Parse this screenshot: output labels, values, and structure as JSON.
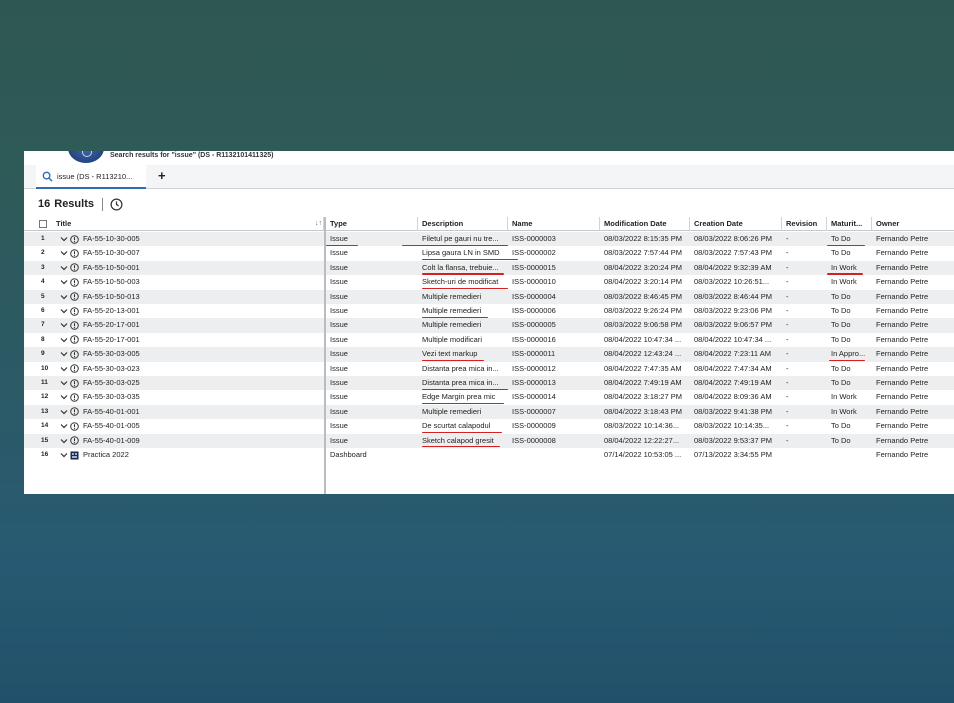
{
  "header": {
    "search_caption": "Search results for \"issue\" (DS - R1132101411325)"
  },
  "tabs": [
    {
      "label": "issue (DS - R113210...",
      "icon": "search-icon"
    }
  ],
  "tab_add_label": "+",
  "results": {
    "count": "16",
    "label": "Results",
    "history_icon": "clock-icon"
  },
  "columns": [
    "Title",
    "Type",
    "Description",
    "Name",
    "Modification Date",
    "Creation Date",
    "Revision",
    "Maturit...",
    "Owner"
  ],
  "colors": {
    "accent": "#2f6db5",
    "annotation_underline": "#d62020"
  },
  "rows": [
    {
      "num": "1",
      "title": "FA-55-10-30-005",
      "type": "Issue",
      "description": "Filetul pe gauri nu tre...",
      "name": "ISS-0000003",
      "modified": "08/03/2022 8:15:35 PM",
      "created": "08/03/2022 8:06:26 PM",
      "revision": "-",
      "maturity": "To Do",
      "owner": "Fernando Petre"
    },
    {
      "num": "2",
      "title": "FA-55-10-30-007",
      "type": "Issue",
      "description": "Lipsa gaura LN in SMD",
      "name": "ISS-0000002",
      "modified": "08/03/2022 7:57:44 PM",
      "created": "08/03/2022 7:57:43 PM",
      "revision": "-",
      "maturity": "To Do",
      "owner": "Fernando Petre"
    },
    {
      "num": "3",
      "title": "FA-55-10-50-001",
      "type": "Issue",
      "description": "Colt la flansa, trebuie...",
      "name": "ISS-0000015",
      "modified": "08/04/2022 3:20:24 PM",
      "created": "08/04/2022 9:32:39 AM",
      "revision": "-",
      "maturity": "In Work",
      "owner": "Fernando Petre"
    },
    {
      "num": "4",
      "title": "FA-55-10-50-003",
      "type": "Issue",
      "description": "Sketch-uri de modificat",
      "name": "ISS-0000010",
      "modified": "08/04/2022 3:20:14 PM",
      "created": "08/03/2022 10:26:51...",
      "revision": "-",
      "maturity": "In Work",
      "owner": "Fernando Petre"
    },
    {
      "num": "5",
      "title": "FA-55-10-50-013",
      "type": "Issue",
      "description": "Multiple remedieri",
      "name": "ISS-0000004",
      "modified": "08/03/2022 8:46:45 PM",
      "created": "08/03/2022 8:46:44 PM",
      "revision": "-",
      "maturity": "To Do",
      "owner": "Fernando Petre"
    },
    {
      "num": "6",
      "title": "FA-55-20-13-001",
      "type": "Issue",
      "description": "Multiple remedieri",
      "name": "ISS-0000006",
      "modified": "08/03/2022 9:26:24 PM",
      "created": "08/03/2022 9:23:06 PM",
      "revision": "-",
      "maturity": "To Do",
      "owner": "Fernando Petre"
    },
    {
      "num": "7",
      "title": "FA-55-20-17-001",
      "type": "Issue",
      "description": "Multiple remedieri",
      "name": "ISS-0000005",
      "modified": "08/03/2022 9:06:58 PM",
      "created": "08/03/2022 9:06:57 PM",
      "revision": "-",
      "maturity": "To Do",
      "owner": "Fernando Petre"
    },
    {
      "num": "8",
      "title": "FA-55-20-17-001",
      "type": "Issue",
      "description": "Multiple modificari",
      "name": "ISS-0000016",
      "modified": "08/04/2022 10:47:34 ...",
      "created": "08/04/2022 10:47:34 ...",
      "revision": "-",
      "maturity": "To Do",
      "owner": "Fernando Petre"
    },
    {
      "num": "9",
      "title": "FA-55-30-03-005",
      "type": "Issue",
      "description": "Vezi text markup",
      "name": "ISS-0000011",
      "modified": "08/04/2022 12:43:24 ...",
      "created": "08/04/2022 7:23:11 AM",
      "revision": "-",
      "maturity": "In Appro...",
      "owner": "Fernando Petre"
    },
    {
      "num": "10",
      "title": "FA-55-30-03-023",
      "type": "Issue",
      "description": "Distanta prea mica in...",
      "name": "ISS-0000012",
      "modified": "08/04/2022 7:47:35 AM",
      "created": "08/04/2022 7:47:34 AM",
      "revision": "-",
      "maturity": "To Do",
      "owner": "Fernando Petre"
    },
    {
      "num": "11",
      "title": "FA-55-30-03-025",
      "type": "Issue",
      "description": "Distanta prea mica in...",
      "name": "ISS-0000013",
      "modified": "08/04/2022 7:49:19 AM",
      "created": "08/04/2022 7:49:19 AM",
      "revision": "-",
      "maturity": "To Do",
      "owner": "Fernando Petre"
    },
    {
      "num": "12",
      "title": "FA-55-30-03-035",
      "type": "Issue",
      "description": "Edge Margin prea mic",
      "name": "ISS-0000014",
      "modified": "08/04/2022 3:18:27 PM",
      "created": "08/04/2022 8:09:36 AM",
      "revision": "-",
      "maturity": "In Work",
      "owner": "Fernando Petre"
    },
    {
      "num": "13",
      "title": "FA-55-40-01-001",
      "type": "Issue",
      "description": "Multiple remedieri",
      "name": "ISS-0000007",
      "modified": "08/04/2022 3:18:43 PM",
      "created": "08/03/2022 9:41:38 PM",
      "revision": "-",
      "maturity": "In Work",
      "owner": "Fernando Petre"
    },
    {
      "num": "14",
      "title": "FA-55-40-01-005",
      "type": "Issue",
      "description": "De scurtat calapodul",
      "name": "ISS-0000009",
      "modified": "08/03/2022 10:14:36...",
      "created": "08/03/2022 10:14:35...",
      "revision": "-",
      "maturity": "To Do",
      "owner": "Fernando Petre"
    },
    {
      "num": "15",
      "title": "FA-55-40-01-009",
      "type": "Issue",
      "description": "Sketch calapod gresit",
      "name": "ISS-0000008",
      "modified": "08/04/2022 12:22:27...",
      "created": "08/03/2022 9:53:37 PM",
      "revision": "-",
      "maturity": "To Do",
      "owner": "Fernando Petre"
    },
    {
      "num": "16",
      "title": "Practica 2022",
      "type": "Dashboard",
      "description": "",
      "name": "",
      "modified": "07/14/2022 10:53:05 ...",
      "created": "07/13/2022 3:34:55 PM",
      "revision": "",
      "maturity": "",
      "owner": "Fernando Petre"
    }
  ]
}
